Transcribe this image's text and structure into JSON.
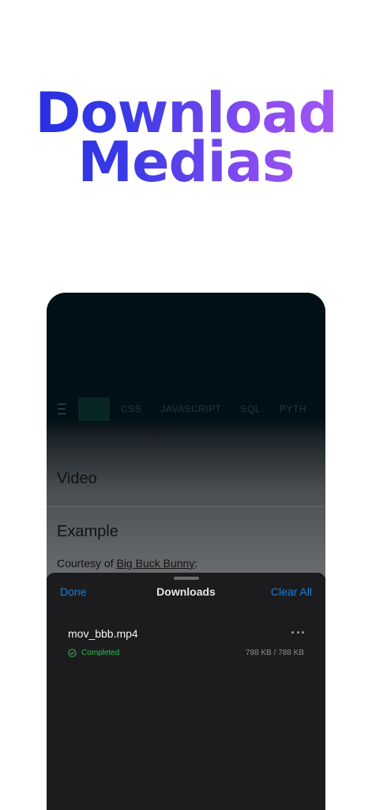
{
  "hero": {
    "line1": "Download",
    "line2": "Medias"
  },
  "web": {
    "nav": [
      "CSS",
      "JAVASCRIPT",
      "SQL",
      "PYTH"
    ],
    "intro_text": "video on a web page.",
    "heading_video": "Video",
    "heading_example": "Example",
    "courtesy_prefix": "Courtesy of ",
    "courtesy_link": "Big Buck Bunny",
    "courtesy_suffix": ":"
  },
  "sheet": {
    "done_label": "Done",
    "title": "Downloads",
    "clear_label": "Clear All",
    "items": [
      {
        "name": "mov_bbb.mp4",
        "status": "Completed",
        "size": "788 KB / 788 KB"
      }
    ]
  },
  "colors": {
    "accent": "#1a7fd8",
    "success": "#2fbf4f",
    "sheet_bg": "#1c1c1e"
  },
  "icons": {
    "more": "ellipsis-icon",
    "status": "check-circle-icon",
    "menu": "hamburger-icon"
  }
}
